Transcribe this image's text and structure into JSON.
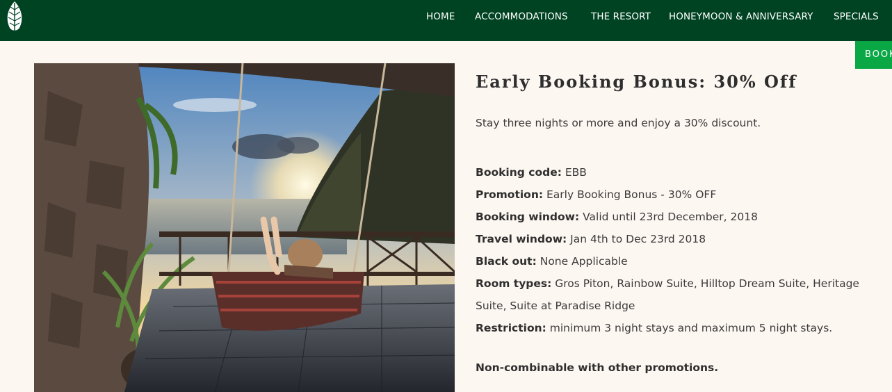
{
  "nav": {
    "logo_icon": "leaf-icon",
    "links": [
      {
        "label": "HOME"
      },
      {
        "label": "ACCOMMODATIONS"
      },
      {
        "label": "THE RESORT"
      },
      {
        "label": "HONEYMOON & ANNIVERSARY"
      },
      {
        "label": "SPECIALS"
      }
    ],
    "book_label": "BOOK",
    "bg_color": "#004322",
    "book_color": "#0aa845"
  },
  "offer": {
    "title": "Early Booking Bonus: 30% Off",
    "intro": "Stay three nights or more and enjoy a 30% discount.",
    "details": [
      {
        "label": "Booking code:",
        "value": "EBB"
      },
      {
        "label": "Promotion:",
        "value": "Early Booking Bonus - 30% OFF"
      },
      {
        "label": "Booking window:",
        "value": "Valid until 23rd December, 2018"
      },
      {
        "label": "Travel window:",
        "value": "Jan 4th to Dec 23rd 2018"
      },
      {
        "label": "Black out:",
        "value": "None Applicable"
      },
      {
        "label": "Room types:",
        "value": "Gros Piton, Rainbow Suite, Hilltop Dream Suite, Heritage Suite, Suite at Paradise Ridge"
      },
      {
        "label": "Restriction:",
        "value": "minimum 3 night stays and maximum 5 night stays."
      }
    ],
    "note": "Non-combinable with other promotions."
  }
}
